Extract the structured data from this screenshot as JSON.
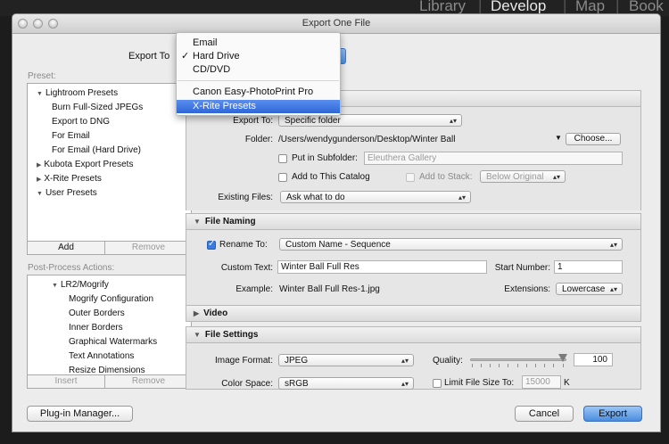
{
  "modules": [
    "Library",
    "Develop",
    "Map",
    "Book"
  ],
  "active_module": "Develop",
  "window": {
    "title": "Export One File"
  },
  "export_to": {
    "label": "Export To",
    "menu": {
      "items": [
        "Email",
        "Hard Drive",
        "CD/DVD",
        "Canon Easy-PhotoPrint Pro",
        "X-Rite Presets"
      ],
      "checked": "Hard Drive",
      "highlighted": "X-Rite Presets",
      "check_glyph": "✓"
    }
  },
  "preset": {
    "label": "Preset:",
    "groups": [
      {
        "name": "Lightroom Presets",
        "expanded": true,
        "children": [
          "Burn Full-Sized JPEGs",
          "Export to DNG",
          "For Email",
          "For Email (Hard Drive)"
        ]
      },
      {
        "name": "Kubota Export Presets",
        "expanded": false
      },
      {
        "name": "X-Rite Presets",
        "expanded": false
      },
      {
        "name": "User Presets",
        "expanded": true
      }
    ],
    "add_label": "Add",
    "remove_label": "Remove"
  },
  "post_process": {
    "label": "Post-Process Actions:",
    "group": "LR2/Mogrify",
    "children": [
      "Mogrify Configuration",
      "Outer Borders",
      "Inner Borders",
      "Graphical Watermarks",
      "Text Annotations",
      "Resize Dimensions"
    ],
    "insert_label": "Insert",
    "remove_label": "Remove"
  },
  "location": {
    "export_to_label": "Export To:",
    "export_to_value": "Specific folder",
    "folder_label": "Folder:",
    "folder_path": "/Users/wendygunderson/Desktop/Winter Ball",
    "choose_label": "Choose...",
    "subfolder_label": "Put in Subfolder:",
    "subfolder_value": "Eleuthera Gallery",
    "add_catalog_label": "Add to This Catalog",
    "add_stack_label": "Add to Stack:",
    "stack_value": "Below Original",
    "existing_label": "Existing Files:",
    "existing_value": "Ask what to do"
  },
  "file_naming": {
    "header": "File Naming",
    "rename_label": "Rename To:",
    "rename_checked": true,
    "template": "Custom Name - Sequence",
    "custom_text_label": "Custom Text:",
    "custom_text": "Winter Ball Full Res",
    "start_number_label": "Start Number:",
    "start_number": "1",
    "example_label": "Example:",
    "example": "Winter Ball Full Res-1.jpg",
    "extensions_label": "Extensions:",
    "extensions_value": "Lowercase"
  },
  "video": {
    "header": "Video"
  },
  "file_settings": {
    "header": "File Settings",
    "format_label": "Image Format:",
    "format_value": "JPEG",
    "quality_label": "Quality:",
    "quality_value": "100",
    "quality_level": 100,
    "colorspace_label": "Color Space:",
    "colorspace_value": "sRGB",
    "limit_label": "Limit File Size To:",
    "limit_value": "15000",
    "limit_unit": "K"
  },
  "footer": {
    "plugin_label": "Plug-in Manager...",
    "cancel_label": "Cancel",
    "export_label": "Export"
  }
}
